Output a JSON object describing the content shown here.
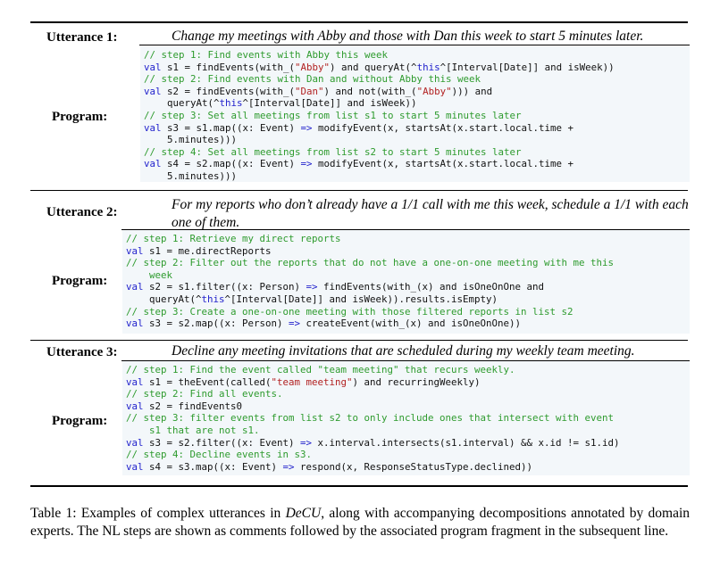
{
  "rows": [
    {
      "utterance_label": "Utterance 1:",
      "utterance_lines": [
        "Change my meetings with Abby and those with Dan this week to start 5 minutes later."
      ],
      "program_label": "Program:",
      "code_lines": [
        [
          [
            "cm",
            "// step 1: Find events with Abby this week"
          ]
        ],
        [
          [
            "kw",
            "val"
          ],
          [
            "",
            "s1 = findEvents(with_("
          ],
          [
            "st",
            "\"Abby\""
          ],
          [
            "",
            ") and queryAt(^"
          ],
          [
            "kw",
            "this"
          ],
          [
            "",
            "^[Interval[Date]] and isWeek))"
          ]
        ],
        [
          [
            "cm",
            "// step 2: Find events with Dan and without Abby this week"
          ]
        ],
        [
          [
            "kw",
            "val"
          ],
          [
            "",
            "s2 = findEvents(with_("
          ],
          [
            "st",
            "\"Dan\""
          ],
          [
            "",
            ") and not(with_("
          ],
          [
            "st",
            "\"Abby\""
          ],
          [
            "",
            "))) and"
          ]
        ],
        [
          [
            "",
            "    queryAt(^"
          ],
          [
            "kw",
            "this"
          ],
          [
            "",
            "^[Interval[Date]] and isWeek))"
          ]
        ],
        [
          [
            "cm",
            "// step 3: Set all meetings from list s1 to start 5 minutes later"
          ]
        ],
        [
          [
            "kw",
            "val"
          ],
          [
            "",
            "s3 = s1.map((x: Event) "
          ],
          [
            "kw",
            "=>"
          ],
          [
            "",
            " modifyEvent(x, startsAt(x.start.local.time +"
          ]
        ],
        [
          [
            "",
            "    5.minutes)))"
          ]
        ],
        [
          [
            "cm",
            "// step 4: Set all meetings from list s2 to start 5 minutes later"
          ]
        ],
        [
          [
            "kw",
            "val"
          ],
          [
            "",
            "s4 = s2.map((x: Event) "
          ],
          [
            "kw",
            "=>"
          ],
          [
            "",
            " modifyEvent(x, startsAt(x.start.local.time +"
          ]
        ],
        [
          [
            "",
            "    5.minutes)))"
          ]
        ]
      ]
    },
    {
      "utterance_label": "Utterance 2:",
      "utterance_lines": [
        "For my reports who don’t already have a 1/1 call with me this week, schedule a 1/1 with each",
        "one of them."
      ],
      "program_label": "Program:",
      "code_lines": [
        [
          [
            "cm",
            "// step 1: Retrieve my direct reports"
          ]
        ],
        [
          [
            "kw",
            "val"
          ],
          [
            "",
            "s1 = me.directReports"
          ]
        ],
        [
          [
            "cm",
            "// step 2: Filter out the reports that do not have a one-on-one meeting with me this"
          ]
        ],
        [
          [
            "cm",
            "    week"
          ]
        ],
        [
          [
            "kw",
            "val"
          ],
          [
            "",
            "s2 = s1.filter((x: Person) "
          ],
          [
            "kw",
            "=>"
          ],
          [
            "",
            " findEvents(with_(x) and isOneOnOne and"
          ]
        ],
        [
          [
            "",
            "    queryAt(^"
          ],
          [
            "kw",
            "this"
          ],
          [
            "",
            "^[Interval[Date]] and isWeek)).results.isEmpty)"
          ]
        ],
        [
          [
            "cm",
            "// step 3: Create a one-on-one meeting with those filtered reports in list s2"
          ]
        ],
        [
          [
            "kw",
            "val"
          ],
          [
            "",
            "s3 = s2.map((x: Person) "
          ],
          [
            "kw",
            "=>"
          ],
          [
            "",
            " createEvent(with_(x) and isOneOnOne))"
          ]
        ]
      ]
    },
    {
      "utterance_label": "Utterance 3:",
      "utterance_lines": [
        "Decline any meeting invitations that are scheduled during my weekly team meeting."
      ],
      "program_label": "Program:",
      "code_lines": [
        [
          [
            "cm",
            "// step 1: Find the event called \"team meeting\" that recurs weekly."
          ]
        ],
        [
          [
            "kw",
            "val"
          ],
          [
            "",
            "s1 = theEvent(called("
          ],
          [
            "st",
            "\"team meeting\""
          ],
          [
            "",
            ") and recurringWeekly)"
          ]
        ],
        [
          [
            "cm",
            "// step 2: Find all events."
          ]
        ],
        [
          [
            "kw",
            "val"
          ],
          [
            "",
            "s2 = findEvents0"
          ]
        ],
        [
          [
            "cm",
            "// step 3: filter events from list s2 to only include ones that intersect with event"
          ]
        ],
        [
          [
            "cm",
            "    s1 that are not s1."
          ]
        ],
        [
          [
            "kw",
            "val"
          ],
          [
            "",
            "s3 = s2.filter((x: Event) "
          ],
          [
            "kw",
            "=>"
          ],
          [
            "",
            " x.interval.intersects(s1.interval) && x.id != s1.id)"
          ]
        ],
        [
          [
            "cm",
            "// step 4: Decline events in s3."
          ]
        ],
        [
          [
            "kw",
            "val"
          ],
          [
            "",
            "s4 = s3.map((x: Event) "
          ],
          [
            "kw",
            "=>"
          ],
          [
            "",
            " respond(x, ResponseStatusType.declined))"
          ]
        ]
      ]
    }
  ],
  "caption": {
    "prefix": "Table 1: Examples of complex utterances in ",
    "system": "DeCU",
    "suffix": ", along with accompanying decompositions annotated by domain experts. The NL steps are shown as comments followed by the associated program fragment in the subsequent line."
  }
}
